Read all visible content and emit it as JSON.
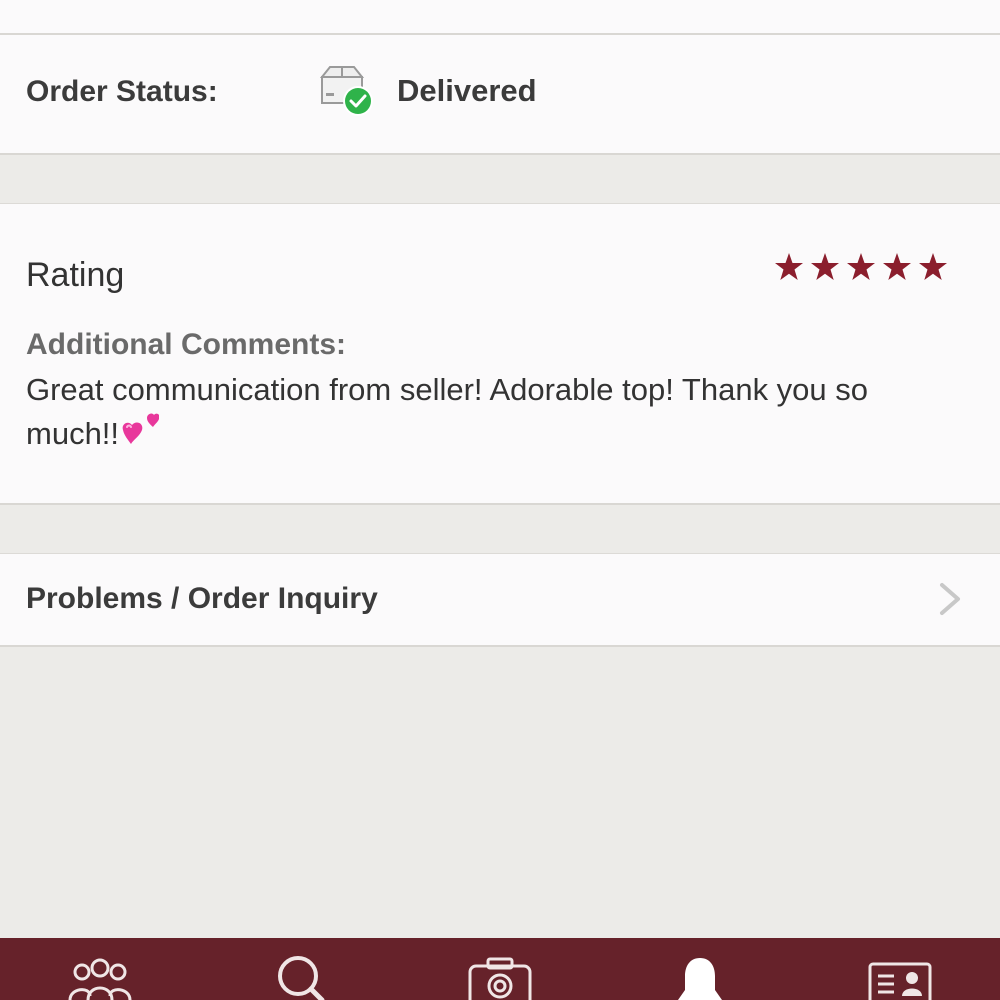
{
  "order_status": {
    "label": "Order Status:",
    "value": "Delivered",
    "icon": "package-delivered-icon",
    "check_color": "#2fb34a"
  },
  "rating": {
    "title": "Rating",
    "stars": 5,
    "max_stars": 5,
    "star_color": "#8b1e2d",
    "comments_label": "Additional Comments:",
    "comments": "Great communication from seller! Adorable top! Thank you so much!!",
    "comments_emoji": "two-hearts-icon"
  },
  "inquiry": {
    "label": "Problems / Order Inquiry"
  },
  "tab_bar": {
    "background": "#66222a",
    "tabs": [
      {
        "icon": "community-icon"
      },
      {
        "icon": "search-icon"
      },
      {
        "icon": "camera-icon"
      },
      {
        "icon": "notifications-icon"
      },
      {
        "icon": "account-icon"
      }
    ]
  }
}
